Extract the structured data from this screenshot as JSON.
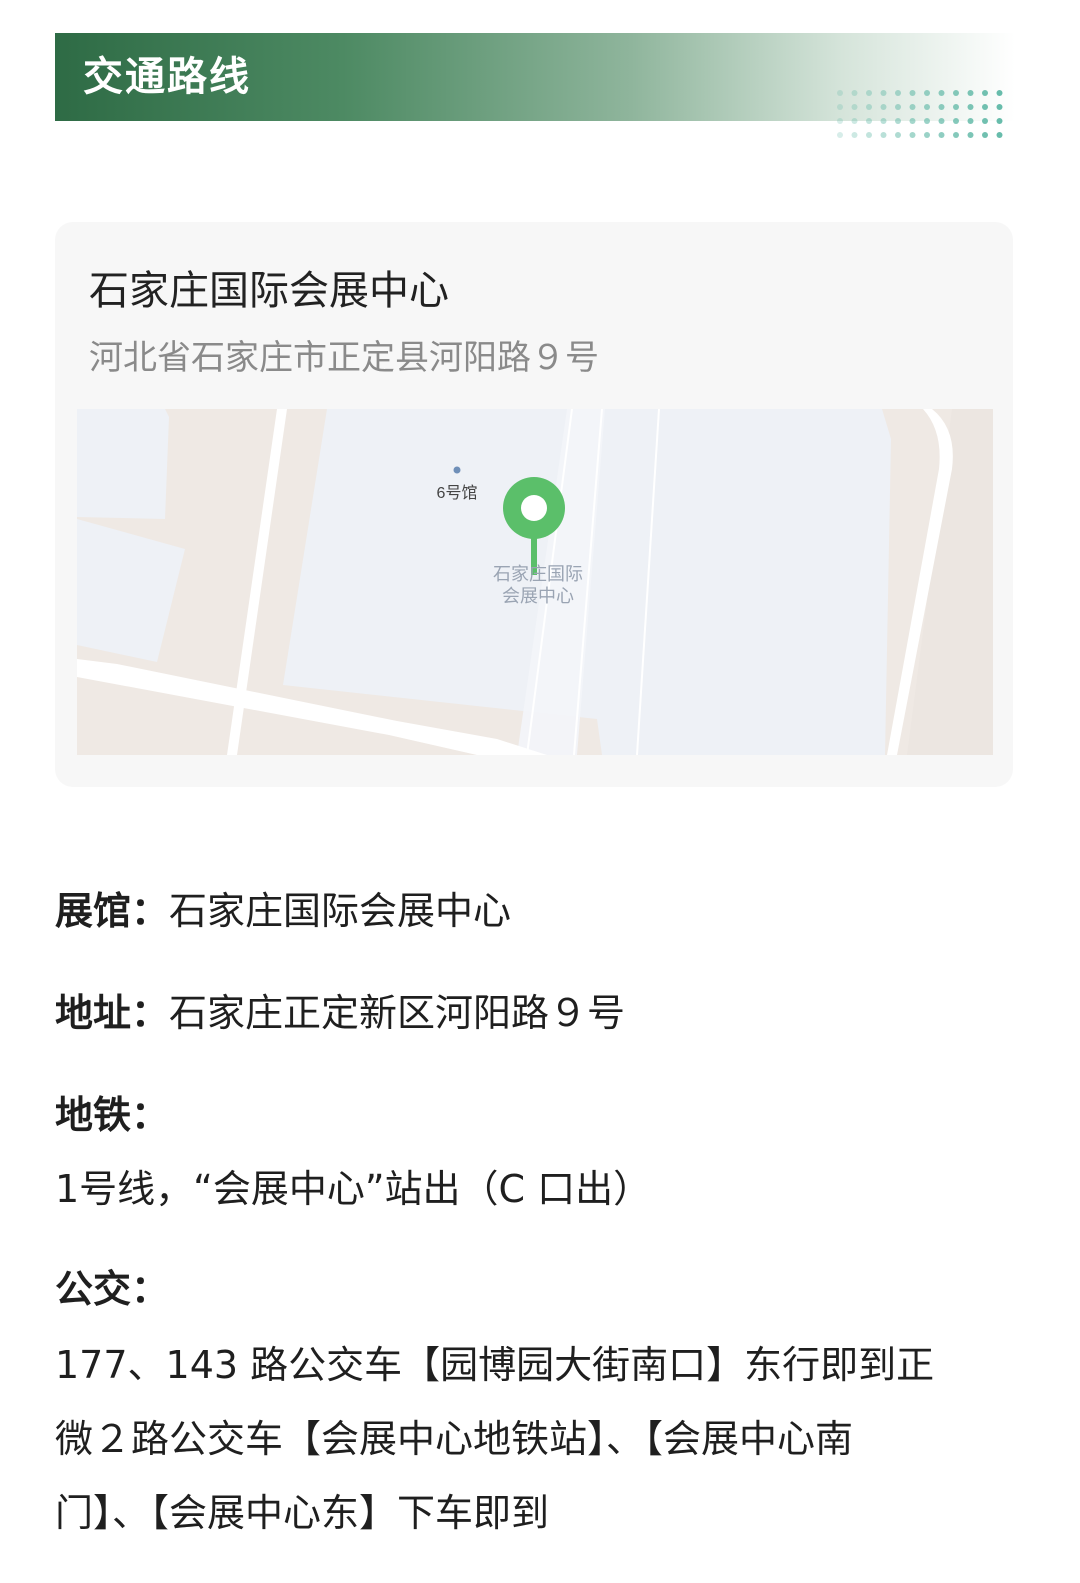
{
  "section": {
    "title": "交通路线"
  },
  "venue_card": {
    "name": "石家庄国际会展中心",
    "address": "河北省石家庄市正定县河阳路９号",
    "map": {
      "poi_label": "6号馆",
      "marker_label_line1": "石家庄国际",
      "marker_label_line2": "会展中心",
      "marker_color": "#5bbf6a"
    }
  },
  "info": {
    "venue_label": "展馆：",
    "venue_value": "石家庄国际会展中心",
    "address_label": "地址：",
    "address_value": "石家庄正定新区河阳路９号",
    "subway_label": "地铁：",
    "subway_value": "1号线，“会展中心”站出（C 口出）",
    "bus_label": "公交：",
    "bus_lines": [
      "177、143 路公交车【园博园大街南口】东行即到正",
      "微２路公交车【会展中心地铁站】、【会展中心南",
      "门】、【会展中心东】下车即到"
    ]
  },
  "colors": {
    "brand_green": "#2e6b45",
    "dot_teal": "#5fb8a6"
  }
}
